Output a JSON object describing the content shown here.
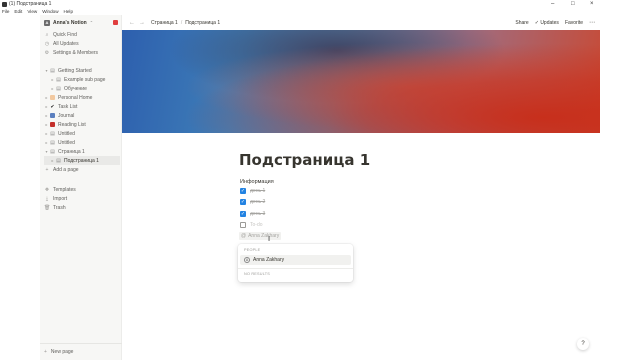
{
  "window": {
    "title": "(1) Подстраница 1",
    "controls": {
      "minimize": "–",
      "maximize": "□",
      "close": "×"
    }
  },
  "menubar": [
    "File",
    "Edit",
    "View",
    "Window",
    "Help"
  ],
  "sidebar": {
    "workspace": {
      "avatar_letter": "A",
      "name": "Anna's Notion",
      "chevron": "⌃"
    },
    "nav": [
      {
        "label": "Quick Find",
        "icon": "search-icon"
      },
      {
        "label": "All Updates",
        "icon": "clock-icon"
      },
      {
        "label": "Settings & Members",
        "icon": "gear-icon"
      }
    ],
    "pages": [
      {
        "label": "Getting Started",
        "icon": "page-icon",
        "arrow": "▾"
      },
      {
        "label": "Example sub page",
        "icon": "page-icon",
        "arrow": "▸"
      },
      {
        "label": "Обучение",
        "icon": "page-icon",
        "arrow": "▸"
      },
      {
        "label": "Personal Home",
        "icon": "house-icon",
        "arrow": "▸"
      },
      {
        "label": "Task List",
        "icon": "checkmark-icon",
        "arrow": "▸"
      },
      {
        "label": "Journal",
        "icon": "notebook-icon",
        "arrow": "▸"
      },
      {
        "label": "Reading List",
        "icon": "book-icon",
        "arrow": "▸"
      },
      {
        "label": "Untitled",
        "icon": "page-icon",
        "arrow": "▸"
      },
      {
        "label": "Untitled",
        "icon": "page-icon",
        "arrow": "▸"
      },
      {
        "label": "Страница 1",
        "icon": "page-icon",
        "arrow": "▾"
      },
      {
        "label": "Подстраница 1",
        "icon": "page-icon",
        "arrow": "▸"
      }
    ],
    "add_page": "Add a page",
    "footer": [
      {
        "label": "Templates",
        "icon": "templates-icon"
      },
      {
        "label": "Import",
        "icon": "import-icon"
      },
      {
        "label": "Trash",
        "icon": "trash-icon"
      }
    ],
    "new_page": "New page"
  },
  "topbar": {
    "back": "←",
    "forward": "→",
    "breadcrumb": [
      "Страница 1",
      "Подстраница 1"
    ],
    "breadcrumb_sep": "/",
    "share": "Share",
    "updates": "Updates",
    "favorite": "Favorite",
    "more": "⋯"
  },
  "page": {
    "title": "Подстраница 1",
    "heading": "Информация",
    "todos": [
      {
        "text": "день 1",
        "checked": true
      },
      {
        "text": "день 2",
        "checked": true
      },
      {
        "text": "день 3",
        "checked": true
      },
      {
        "text": "To-do",
        "checked": false
      }
    ],
    "mention_query": "Anna Zakhary"
  },
  "mention_popup": {
    "section_people": "PEOPLE",
    "person": "Anna Zakhary",
    "section_none": "NO RESULTS"
  },
  "help_button": "?",
  "colors": {
    "accent": "#2383e2",
    "sidebar_bg": "#f7f7f5"
  }
}
